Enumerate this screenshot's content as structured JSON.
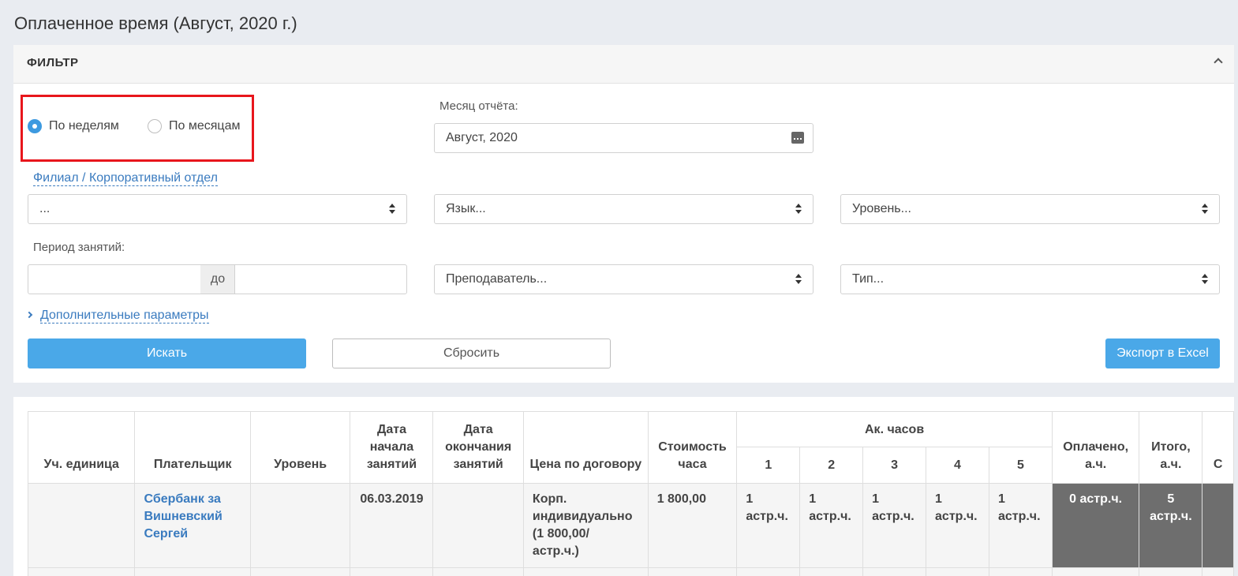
{
  "page": {
    "title": "Оплаченное время (Август, 2020 г.)"
  },
  "filter": {
    "header": "ФИЛЬТР",
    "period_mode": {
      "options": [
        "По неделям",
        "По месяцам"
      ],
      "selected": "По неделям"
    },
    "report_month": {
      "label": "Месяц отчёта:",
      "value": "Август, 2020"
    },
    "branch": {
      "label": "Филиал / Корпоративный отдел",
      "value": "..."
    },
    "language": {
      "value": "Язык..."
    },
    "level": {
      "value": "Уровень..."
    },
    "class_period": {
      "label": "Период занятий:",
      "from": "",
      "to_label": "до",
      "to": ""
    },
    "teacher": {
      "value": "Преподаватель..."
    },
    "type": {
      "value": "Тип..."
    },
    "additional_params": "Дополнительные параметры",
    "buttons": {
      "search": "Искать",
      "reset": "Сбросить",
      "export": "Экспорт в Excel"
    }
  },
  "table": {
    "headers": {
      "unit": "Уч. единица",
      "payer": "Плательщик",
      "level": "Уровень",
      "start": "Дата начала занятий",
      "end": "Дата окончания занятий",
      "price": "Цена по договору",
      "hour_cost": "Стоимость часа",
      "ak_hours": "Ак. часов",
      "weeks": [
        "1",
        "2",
        "3",
        "4",
        "5"
      ],
      "paid": "Оплачено, а.ч.",
      "total": "Итого, а.ч.",
      "cut": "С"
    },
    "rows": [
      {
        "unit": "",
        "payer": "Сбербанк за Вишневский Сергей",
        "level": "",
        "start": "06.03.2019",
        "end": "",
        "price": "Корп. индивидуально (1 800,00/ астр.ч.)",
        "hour_cost": "1 800,00",
        "weeks": [
          "1 астр.ч.",
          "1 астр.ч.",
          "1 астр.ч.",
          "1 астр.ч.",
          "1 астр.ч."
        ],
        "paid": "0 астр.ч.",
        "total": "5 астр.ч."
      }
    ]
  }
}
